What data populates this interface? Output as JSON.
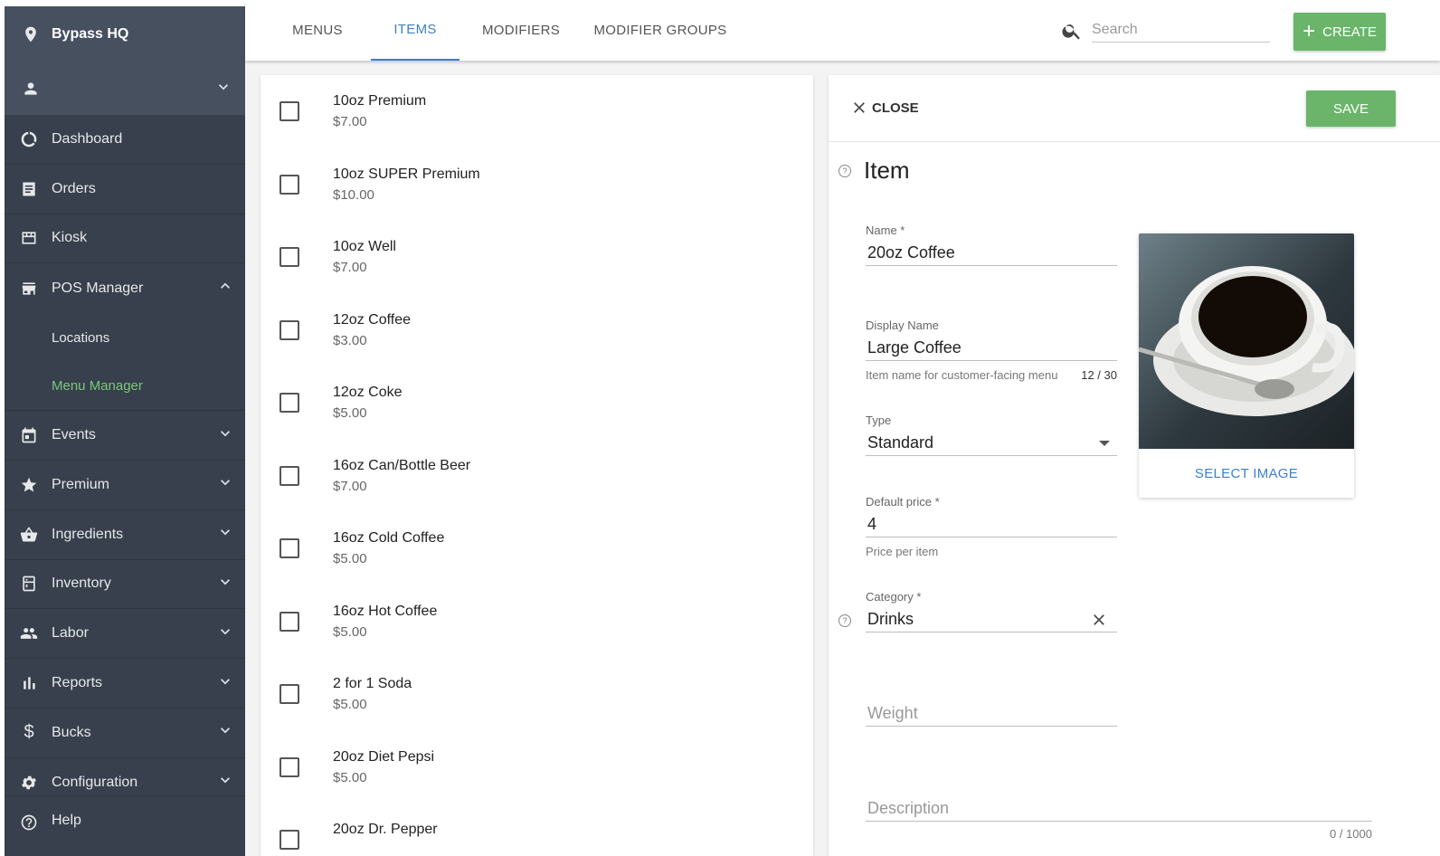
{
  "sidebar": {
    "org_name": "Bypass HQ",
    "items": [
      {
        "label": "Dashboard",
        "icon": "dashboard-icon"
      },
      {
        "label": "Orders",
        "icon": "orders-icon"
      },
      {
        "label": "Kiosk",
        "icon": "kiosk-icon"
      },
      {
        "label": "POS Manager",
        "icon": "store-icon",
        "expanded": true
      }
    ],
    "sub_items": [
      {
        "label": "Locations",
        "active": false
      },
      {
        "label": "Menu Manager",
        "active": true
      }
    ],
    "items_after": [
      {
        "label": "Events",
        "icon": "calendar-icon"
      },
      {
        "label": "Premium",
        "icon": "star-icon"
      },
      {
        "label": "Ingredients",
        "icon": "basket-icon"
      },
      {
        "label": "Inventory",
        "icon": "fridge-icon"
      },
      {
        "label": "Labor",
        "icon": "people-icon"
      },
      {
        "label": "Reports",
        "icon": "bar-chart-icon"
      },
      {
        "label": "Bucks",
        "icon": "dollar-icon"
      },
      {
        "label": "Configuration",
        "icon": "gear-icon"
      }
    ],
    "help_label": "Help"
  },
  "topbar": {
    "tabs": [
      {
        "label": "MENUS",
        "active": false
      },
      {
        "label": "ITEMS",
        "active": true
      },
      {
        "label": "MODIFIERS",
        "active": false
      },
      {
        "label": "MODIFIER GROUPS",
        "active": false
      }
    ],
    "search_placeholder": "Search",
    "search_value": "",
    "create_label": "CREATE"
  },
  "items": [
    {
      "name": "10oz Premium",
      "price": "$7.00"
    },
    {
      "name": "10oz SUPER Premium",
      "price": "$10.00"
    },
    {
      "name": "10oz Well",
      "price": "$7.00"
    },
    {
      "name": "12oz Coffee",
      "price": "$3.00"
    },
    {
      "name": "12oz Coke",
      "price": "$5.00"
    },
    {
      "name": "16oz Can/Bottle Beer",
      "price": "$7.00"
    },
    {
      "name": "16oz Cold Coffee",
      "price": "$5.00"
    },
    {
      "name": "16oz Hot Coffee",
      "price": "$5.00"
    },
    {
      "name": "2 for 1 Soda",
      "price": "$5.00"
    },
    {
      "name": "20oz Diet Pepsi",
      "price": "$5.00"
    },
    {
      "name": "20oz Dr. Pepper",
      "price": ""
    }
  ],
  "detail": {
    "close_label": "CLOSE",
    "save_label": "SAVE",
    "title": "Item",
    "name_label": "Name *",
    "name_value": "20oz Coffee",
    "display_name_label": "Display Name",
    "display_name_value": "Large Coffee",
    "display_name_helper": "Item name for customer-facing menu",
    "display_name_count": "12 / 30",
    "type_label": "Type",
    "type_value": "Standard",
    "price_label": "Default price *",
    "price_value": "4",
    "price_helper": "Price per item",
    "category_label": "Category *",
    "category_value": "Drinks",
    "weight_placeholder": "Weight",
    "description_placeholder": "Description",
    "description_count": "0 / 1000",
    "select_image_label": "SELECT IMAGE"
  },
  "colors": {
    "sidebar_bg": "#37404c",
    "accent_green": "#6ab56a",
    "accent_blue": "#3d7fd1",
    "active_sub_green": "#79c87a"
  }
}
